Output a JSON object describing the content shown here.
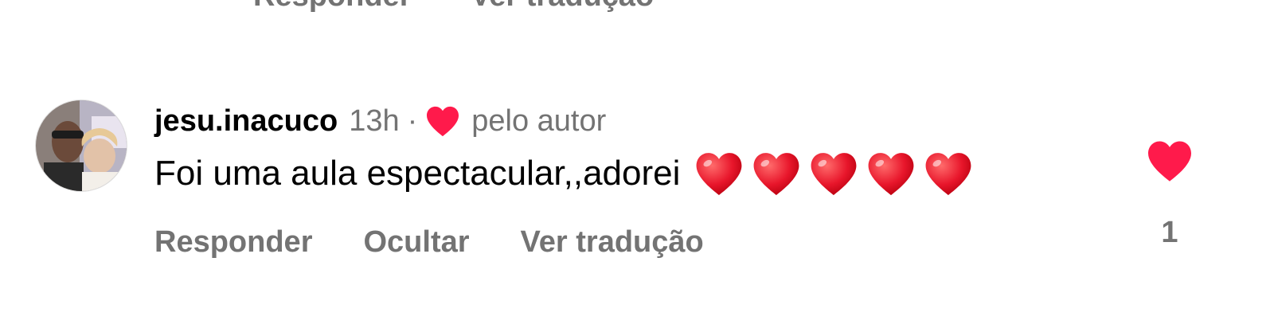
{
  "previous_comment": {
    "actions": [
      "Responder",
      "Ver tradução"
    ]
  },
  "comment": {
    "username": "jesu.inacuco",
    "time": "13h",
    "separator": "·",
    "author_like_label": "pelo autor",
    "text": "Foi uma aula espectacular,,adorei",
    "emoji": [
      "red-heart-emoji",
      "red-heart-emoji",
      "red-heart-emoji",
      "red-heart-emoji",
      "red-heart-emoji"
    ],
    "actions": {
      "reply": "Responder",
      "hide": "Ocultar",
      "translate": "Ver tradução"
    },
    "likes": "1",
    "like_color": "#ff1a4b"
  }
}
